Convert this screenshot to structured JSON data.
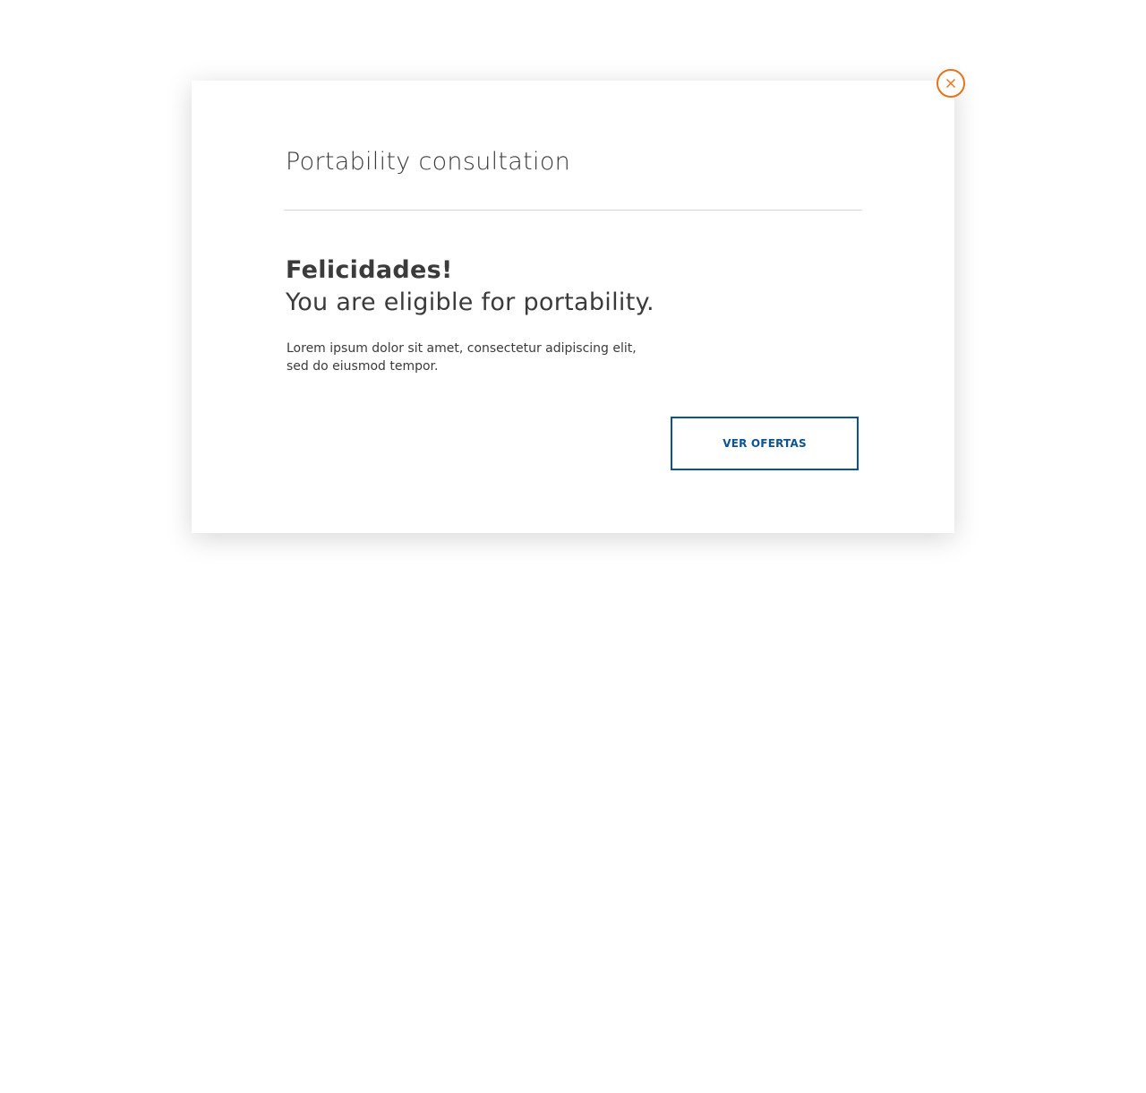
{
  "modal": {
    "title": "Portability consultation",
    "headline": "Felicidades!",
    "subheadline": "You are eligible for portability.",
    "body": "Lorem ipsum dolor sit amet, consectetur adipiscing elit, sed do eiusmod tempor.",
    "cta_label": "VER OFERTAS",
    "close_icon": "close-icon"
  },
  "colors": {
    "accent_orange": "#e8731a",
    "primary_blue": "#0b5394",
    "text": "#3b3b3b",
    "divider": "#d6d6d6"
  }
}
